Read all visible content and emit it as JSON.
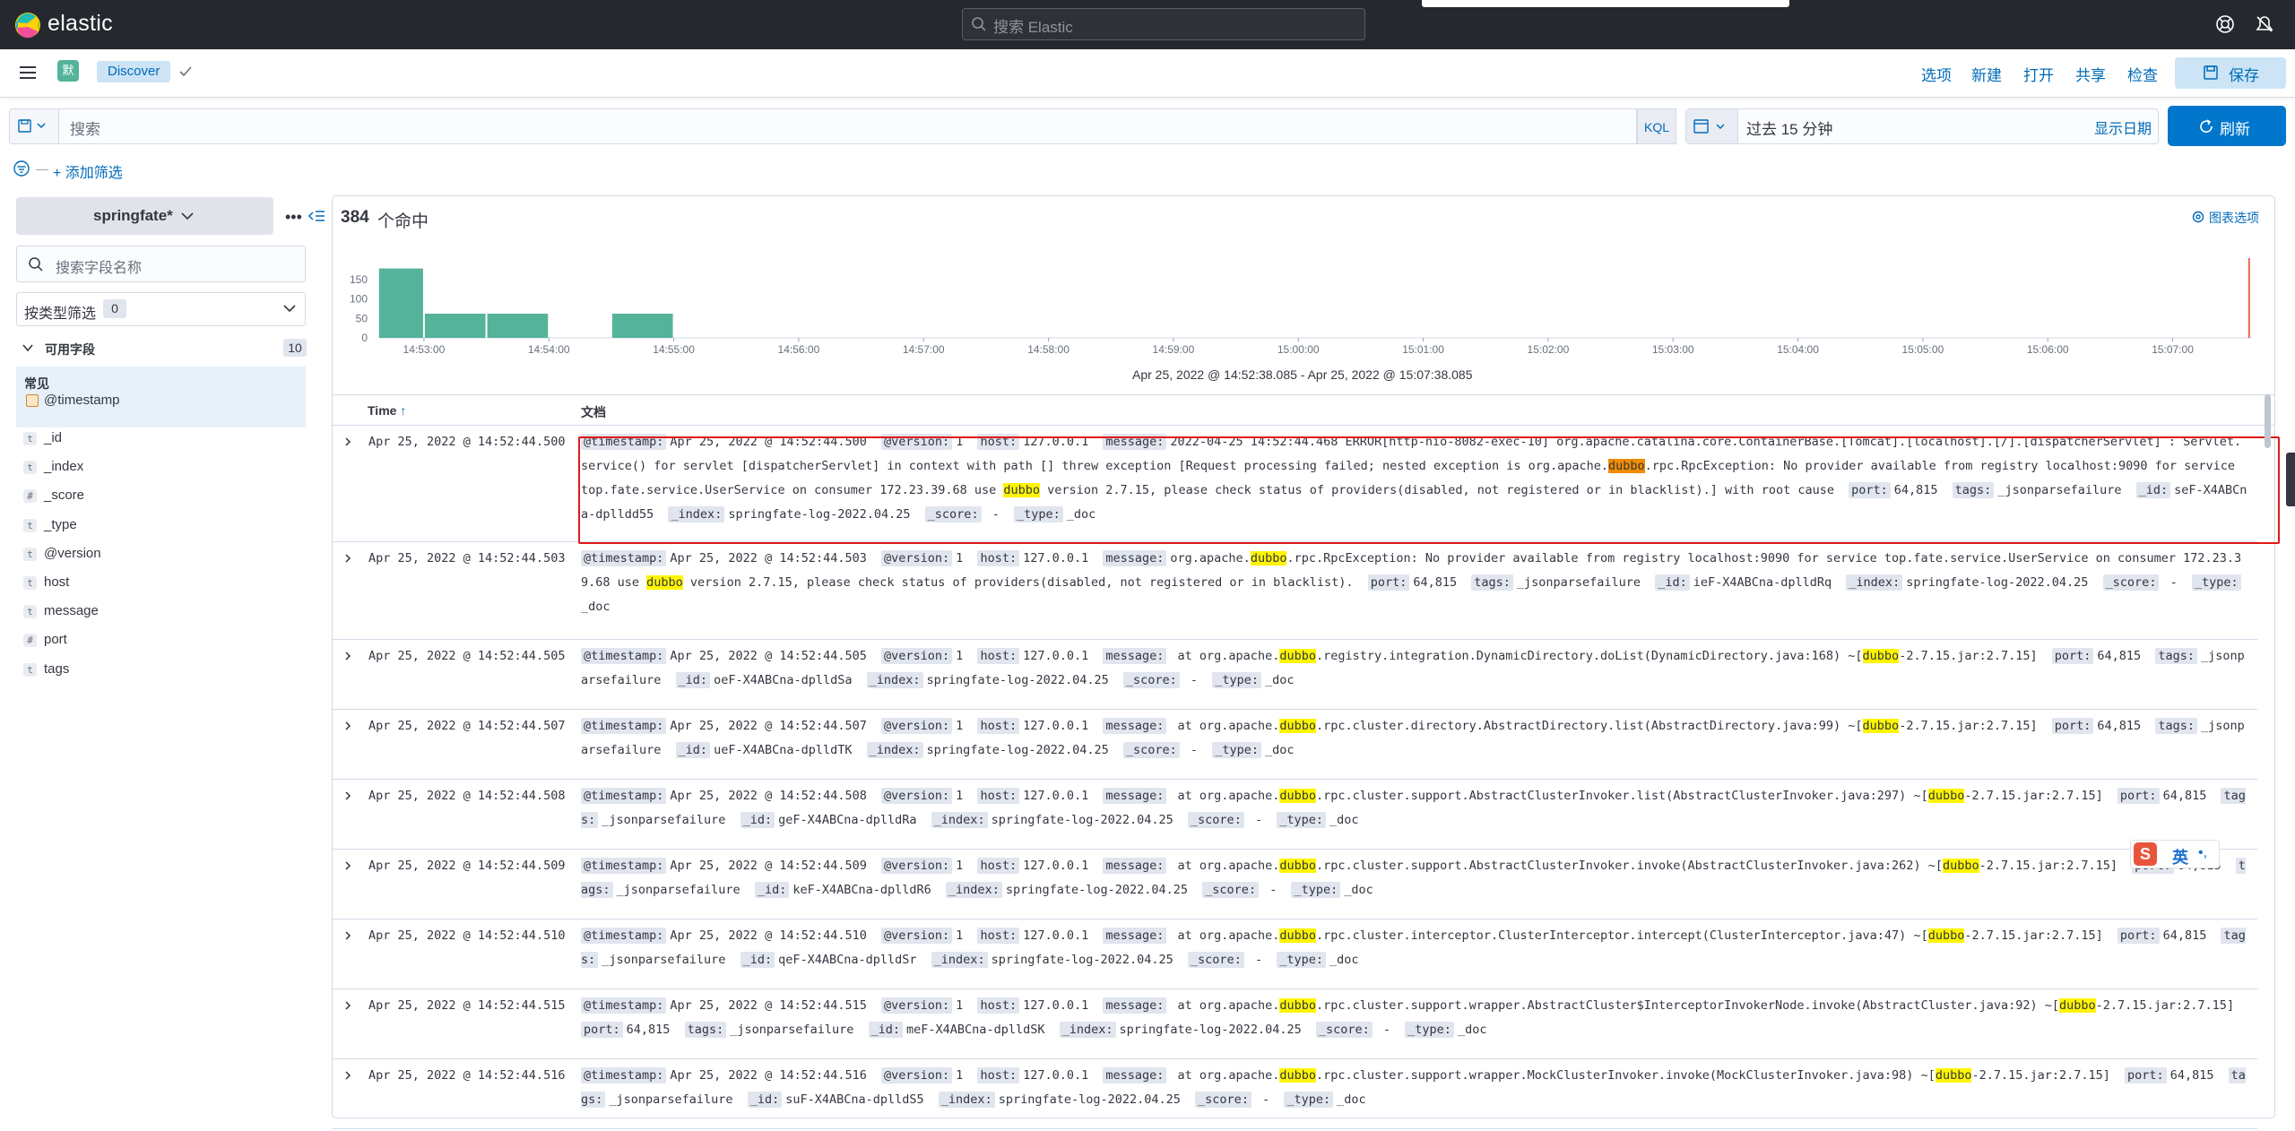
{
  "header": {
    "brand": "elastic",
    "search_placeholder": "搜索 Elastic"
  },
  "nav": {
    "space_initial": "默",
    "breadcrumb": "Discover",
    "links": [
      "选项",
      "新建",
      "打开",
      "共享",
      "检查"
    ],
    "save_label": "保存"
  },
  "query": {
    "placeholder": "搜索",
    "language": "KQL",
    "time_range": "过去 15 分钟",
    "show_dates": "显示日期",
    "refresh_label": "刷新",
    "add_filter": "+ 添加筛选"
  },
  "sidebar": {
    "index_pattern": "springfate*",
    "field_search_placeholder": "搜索字段名称",
    "type_filter_label": "按类型筛选",
    "type_filter_count": "0",
    "available_label": "可用字段",
    "available_count": "10",
    "common_title": "常见",
    "common_field": "@timestamp",
    "fields": [
      {
        "type": "t",
        "name": "_id"
      },
      {
        "type": "t",
        "name": "_index"
      },
      {
        "type": "#",
        "name": "_score"
      },
      {
        "type": "t",
        "name": "_type"
      },
      {
        "type": "t",
        "name": "@version"
      },
      {
        "type": "t",
        "name": "host"
      },
      {
        "type": "t",
        "name": "message"
      },
      {
        "type": "#",
        "name": "port"
      },
      {
        "type": "t",
        "name": "tags"
      }
    ]
  },
  "main": {
    "hits_count": "384",
    "hits_unit": "个命中",
    "chart_options": "图表选项",
    "range_label": "Apr 25, 2022 @ 14:52:38.085 - Apr 25, 2022 @ 15:07:38.085",
    "col_time": "Time",
    "col_doc": "文档"
  },
  "chart_data": {
    "type": "bar",
    "ylim": [
      0,
      200
    ],
    "y_ticks": [
      "150",
      "100",
      "50",
      "0"
    ],
    "x_ticks": [
      "14:53:00",
      "14:54:00",
      "14:55:00",
      "14:56:00",
      "14:57:00",
      "14:58:00",
      "14:59:00",
      "15:00:00",
      "15:01:00",
      "15:02:00",
      "15:03:00",
      "15:04:00",
      "15:05:00",
      "15:06:00",
      "15:07:00"
    ],
    "bars": [
      {
        "start": "14:52:38",
        "end": "14:53:00",
        "value": 178
      },
      {
        "start": "14:53:00",
        "end": "14:53:30",
        "value": 62
      },
      {
        "start": "14:53:30",
        "end": "14:54:00",
        "value": 62
      },
      {
        "start": "14:54:30",
        "end": "14:55:00",
        "value": 62
      }
    ],
    "now_marker": "15:07:38",
    "color": "#54b399"
  },
  "rows": [
    {
      "time": "Apr 25, 2022 @ 14:52:44.500",
      "segs": [
        {
          "k": "@timestamp:",
          "v": "Apr 25, 2022 @ 14:52:44.500"
        },
        {
          "k": "@version:",
          "v": "1"
        },
        {
          "k": "host:",
          "v": "127.0.0.1"
        },
        {
          "k": "message:",
          "p": [
            "2022-04-25 14:52:44.468 ERROR[http-nio-8082-exec-10] org.apache.catalina.core.ContainerBase.[Tomcat].[localhost].[/].[dispatcherServlet] : Servlet.service() for servlet [dispatcherServlet] in context with path [] threw exception [Request processing failed; nested exception is org.apache.",
            {
              "hl2": "dubbo"
            },
            ".rpc.RpcException: No provider available from registry localhost:9090 for service top.fate.service.UserService on consumer 172.23.39.68 use ",
            {
              "hl": "dubbo"
            },
            " version 2.7.15, please check status of providers(disabled, not registered or in blacklist).] with root cause"
          ]
        },
        {
          "k": "port:",
          "v": "64,815"
        },
        {
          "k": "tags:",
          "v": "_jsonparsefailure"
        },
        {
          "k": "_id:",
          "v": "seF-X4ABCna-dplldd55"
        },
        {
          "k": "_index:",
          "v": "springfate-log-2022.04.25"
        },
        {
          "k": "_score:",
          "v": " - "
        },
        {
          "k": "_type:",
          "v": "_doc"
        }
      ]
    },
    {
      "time": "Apr 25, 2022 @ 14:52:44.503",
      "segs": [
        {
          "k": "@timestamp:",
          "v": "Apr 25, 2022 @ 14:52:44.503"
        },
        {
          "k": "@version:",
          "v": "1"
        },
        {
          "k": "host:",
          "v": "127.0.0.1"
        },
        {
          "k": "message:",
          "p": [
            "org.apache.",
            {
              "hl": "dubbo"
            },
            ".rpc.RpcException: No provider available from registry localhost:9090 for service top.fate.service.UserService on consumer 172.23.39.68 use ",
            {
              "hl": "dubbo"
            },
            " version 2.7.15, please check status of providers(disabled, not registered or in blacklist)."
          ]
        },
        {
          "k": "port:",
          "v": "64,815"
        },
        {
          "k": "tags:",
          "v": "_jsonparsefailure"
        },
        {
          "k": "_id:",
          "v": "ieF-X4ABCna-dplldRq"
        },
        {
          "k": "_index:",
          "v": "springfate-log-2022.04.25"
        },
        {
          "k": "_score:",
          "v": " - "
        },
        {
          "k": "_type:",
          "v": "_doc"
        }
      ]
    },
    {
      "time": "Apr 25, 2022 @ 14:52:44.505",
      "segs": [
        {
          "k": "@timestamp:",
          "v": "Apr 25, 2022 @ 14:52:44.505"
        },
        {
          "k": "@version:",
          "v": "1"
        },
        {
          "k": "host:",
          "v": "127.0.0.1"
        },
        {
          "k": "message:",
          "p": [
            " at org.apache.",
            {
              "hl": "dubbo"
            },
            ".registry.integration.DynamicDirectory.doList(DynamicDirectory.java:168) ~[",
            {
              "hl": "dubbo"
            },
            "-2.7.15.jar:2.7.15]"
          ]
        },
        {
          "k": "port:",
          "v": "64,815"
        },
        {
          "k": "tags:",
          "v": "_jsonparsefailure"
        },
        {
          "k": "_id:",
          "v": "oeF-X4ABCna-dplldSa"
        },
        {
          "k": "_index:",
          "v": "springfate-log-2022.04.25"
        },
        {
          "k": "_score:",
          "v": " - "
        },
        {
          "k": "_type:",
          "v": "_doc"
        }
      ]
    },
    {
      "time": "Apr 25, 2022 @ 14:52:44.507",
      "segs": [
        {
          "k": "@timestamp:",
          "v": "Apr 25, 2022 @ 14:52:44.507"
        },
        {
          "k": "@version:",
          "v": "1"
        },
        {
          "k": "host:",
          "v": "127.0.0.1"
        },
        {
          "k": "message:",
          "p": [
            " at org.apache.",
            {
              "hl": "dubbo"
            },
            ".rpc.cluster.directory.AbstractDirectory.list(AbstractDirectory.java:99) ~[",
            {
              "hl": "dubbo"
            },
            "-2.7.15.jar:2.7.15]"
          ]
        },
        {
          "k": "port:",
          "v": "64,815"
        },
        {
          "k": "tags:",
          "v": "_jsonparsefailure"
        },
        {
          "k": "_id:",
          "v": "ueF-X4ABCna-dplldTK"
        },
        {
          "k": "_index:",
          "v": "springfate-log-2022.04.25"
        },
        {
          "k": "_score:",
          "v": " - "
        },
        {
          "k": "_type:",
          "v": "_doc"
        }
      ]
    },
    {
      "time": "Apr 25, 2022 @ 14:52:44.508",
      "segs": [
        {
          "k": "@timestamp:",
          "v": "Apr 25, 2022 @ 14:52:44.508"
        },
        {
          "k": "@version:",
          "v": "1"
        },
        {
          "k": "host:",
          "v": "127.0.0.1"
        },
        {
          "k": "message:",
          "p": [
            " at org.apache.",
            {
              "hl": "dubbo"
            },
            ".rpc.cluster.support.AbstractClusterInvoker.list(AbstractClusterInvoker.java:297) ~[",
            {
              "hl": "dubbo"
            },
            "-2.7.15.jar:2.7.15]"
          ]
        },
        {
          "k": "port:",
          "v": "64,815"
        },
        {
          "k": "tags:",
          "v": "_jsonparsefailure"
        },
        {
          "k": "_id:",
          "v": "geF-X4ABCna-dplldRa"
        },
        {
          "k": "_index:",
          "v": "springfate-log-2022.04.25"
        },
        {
          "k": "_score:",
          "v": " - "
        },
        {
          "k": "_type:",
          "v": "_doc"
        }
      ]
    },
    {
      "time": "Apr 25, 2022 @ 14:52:44.509",
      "segs": [
        {
          "k": "@timestamp:",
          "v": "Apr 25, 2022 @ 14:52:44.509"
        },
        {
          "k": "@version:",
          "v": "1"
        },
        {
          "k": "host:",
          "v": "127.0.0.1"
        },
        {
          "k": "message:",
          "p": [
            " at org.apache.",
            {
              "hl": "dubbo"
            },
            ".rpc.cluster.support.AbstractClusterInvoker.invoke(AbstractClusterInvoker.java:262) ~[",
            {
              "hl": "dubbo"
            },
            "-2.7.15.jar:2.7.15]"
          ]
        },
        {
          "k": "port:",
          "v": "64,815"
        },
        {
          "k": "tags:",
          "v": "_jsonparsefailure"
        },
        {
          "k": "_id:",
          "v": "keF-X4ABCna-dplldR6"
        },
        {
          "k": "_index:",
          "v": "springfate-log-2022.04.25"
        },
        {
          "k": "_score:",
          "v": " - "
        },
        {
          "k": "_type:",
          "v": "_doc"
        }
      ]
    },
    {
      "time": "Apr 25, 2022 @ 14:52:44.510",
      "segs": [
        {
          "k": "@timestamp:",
          "v": "Apr 25, 2022 @ 14:52:44.510"
        },
        {
          "k": "@version:",
          "v": "1"
        },
        {
          "k": "host:",
          "v": "127.0.0.1"
        },
        {
          "k": "message:",
          "p": [
            " at org.apache.",
            {
              "hl": "dubbo"
            },
            ".rpc.cluster.interceptor.ClusterInterceptor.intercept(ClusterInterceptor.java:47) ~[",
            {
              "hl": "dubbo"
            },
            "-2.7.15.jar:2.7.15]"
          ]
        },
        {
          "k": "port:",
          "v": "64,815"
        },
        {
          "k": "tags:",
          "v": "_jsonparsefailure"
        },
        {
          "k": "_id:",
          "v": "qeF-X4ABCna-dplldSr"
        },
        {
          "k": "_index:",
          "v": "springfate-log-2022.04.25"
        },
        {
          "k": "_score:",
          "v": " - "
        },
        {
          "k": "_type:",
          "v": "_doc"
        }
      ]
    },
    {
      "time": "Apr 25, 2022 @ 14:52:44.515",
      "segs": [
        {
          "k": "@timestamp:",
          "v": "Apr 25, 2022 @ 14:52:44.515"
        },
        {
          "k": "@version:",
          "v": "1"
        },
        {
          "k": "host:",
          "v": "127.0.0.1"
        },
        {
          "k": "message:",
          "p": [
            " at org.apache.",
            {
              "hl": "dubbo"
            },
            ".rpc.cluster.support.wrapper.AbstractCluster$InterceptorInvokerNode.invoke(AbstractCluster.java:92) ~[",
            {
              "hl": "dubbo"
            },
            "-2.7.15.jar:2.7.15]"
          ]
        },
        {
          "k": "port:",
          "v": "64,815"
        },
        {
          "k": "tags:",
          "v": "_jsonparsefailure"
        },
        {
          "k": "_id:",
          "v": "meF-X4ABCna-dplldSK"
        },
        {
          "k": "_index:",
          "v": "springfate-log-2022.04.25"
        },
        {
          "k": "_score:",
          "v": " - "
        },
        {
          "k": "_type:",
          "v": "_doc"
        }
      ]
    },
    {
      "time": "Apr 25, 2022 @ 14:52:44.516",
      "segs": [
        {
          "k": "@timestamp:",
          "v": "Apr 25, 2022 @ 14:52:44.516"
        },
        {
          "k": "@version:",
          "v": "1"
        },
        {
          "k": "host:",
          "v": "127.0.0.1"
        },
        {
          "k": "message:",
          "p": [
            " at org.apache.",
            {
              "hl": "dubbo"
            },
            ".rpc.cluster.support.wrapper.MockClusterInvoker.invoke(MockClusterInvoker.java:98) ~[",
            {
              "hl": "dubbo"
            },
            "-2.7.15.jar:2.7.15]"
          ]
        },
        {
          "k": "port:",
          "v": "64,815"
        },
        {
          "k": "tags:",
          "v": "_jsonparsefailure"
        },
        {
          "k": "_id:",
          "v": "suF-X4ABCna-dplldS5"
        },
        {
          "k": "_index:",
          "v": "springfate-log-2022.04.25"
        },
        {
          "k": "_score:",
          "v": " - "
        },
        {
          "k": "_type:",
          "v": "_doc"
        }
      ]
    }
  ],
  "ime": {
    "label": "英",
    "extra": "•,"
  }
}
